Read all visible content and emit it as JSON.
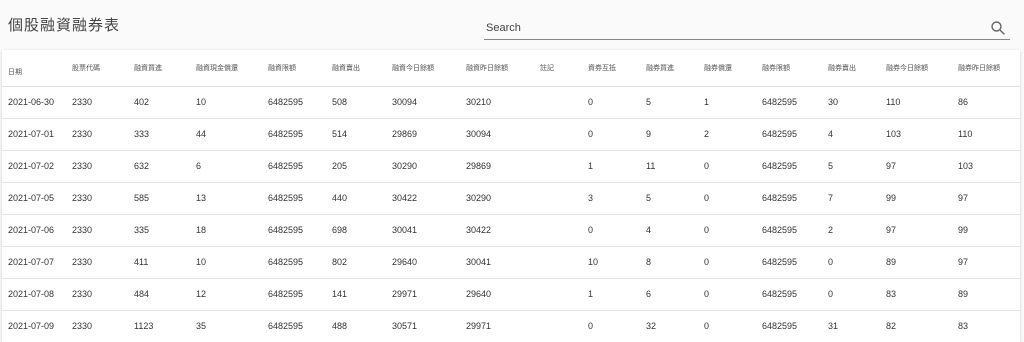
{
  "page": {
    "title": "個股融資融券表"
  },
  "search": {
    "placeholder": "Search",
    "icon": "search-icon"
  },
  "table": {
    "headers": [
      "日期",
      "股票代碼",
      "融資買進",
      "融資現金償還",
      "融資限額",
      "融資賣出",
      "融資今日餘額",
      "融資昨日餘額",
      "註記",
      "資券互抵",
      "融券買進",
      "融券償還",
      "融券限額",
      "融券賣出",
      "融券今日餘額",
      "融券昨日餘額"
    ],
    "rows": [
      [
        "2021-06-30",
        "2330",
        "402",
        "10",
        "6482595",
        "508",
        "30094",
        "30210",
        "",
        "0",
        "5",
        "1",
        "6482595",
        "30",
        "110",
        "86"
      ],
      [
        "2021-07-01",
        "2330",
        "333",
        "44",
        "6482595",
        "514",
        "29869",
        "30094",
        "",
        "0",
        "9",
        "2",
        "6482595",
        "4",
        "103",
        "110"
      ],
      [
        "2021-07-02",
        "2330",
        "632",
        "6",
        "6482595",
        "205",
        "30290",
        "29869",
        "",
        "1",
        "11",
        "0",
        "6482595",
        "5",
        "97",
        "103"
      ],
      [
        "2021-07-05",
        "2330",
        "585",
        "13",
        "6482595",
        "440",
        "30422",
        "30290",
        "",
        "3",
        "5",
        "0",
        "6482595",
        "7",
        "99",
        "97"
      ],
      [
        "2021-07-06",
        "2330",
        "335",
        "18",
        "6482595",
        "698",
        "30041",
        "30422",
        "",
        "0",
        "4",
        "0",
        "6482595",
        "2",
        "97",
        "99"
      ],
      [
        "2021-07-07",
        "2330",
        "411",
        "10",
        "6482595",
        "802",
        "29640",
        "30041",
        "",
        "10",
        "8",
        "0",
        "6482595",
        "0",
        "89",
        "97"
      ],
      [
        "2021-07-08",
        "2330",
        "484",
        "12",
        "6482595",
        "141",
        "29971",
        "29640",
        "",
        "1",
        "6",
        "0",
        "6482595",
        "0",
        "83",
        "89"
      ],
      [
        "2021-07-09",
        "2330",
        "1123",
        "35",
        "6482595",
        "488",
        "30571",
        "29971",
        "",
        "0",
        "32",
        "0",
        "6482595",
        "31",
        "82",
        "83"
      ]
    ]
  }
}
